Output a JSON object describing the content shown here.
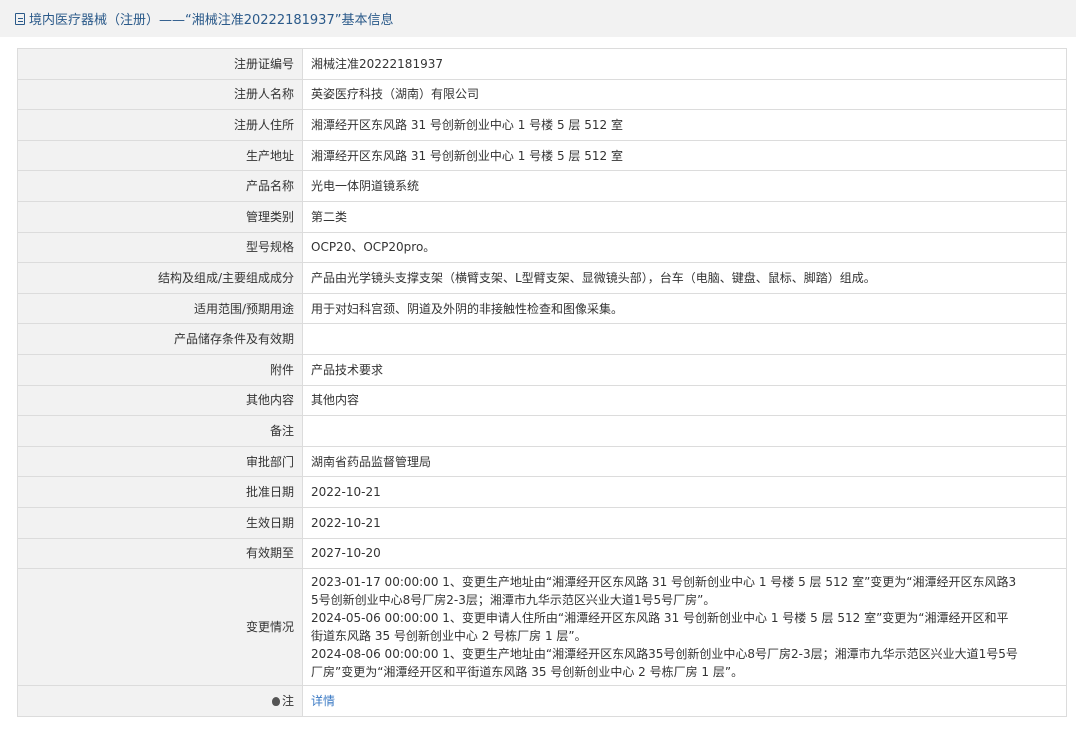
{
  "header": {
    "title": "境内医疗器械（注册）——“湘械注准20222181937”基本信息"
  },
  "rows": [
    {
      "label": "注册证编号",
      "value": "湘械注准20222181937"
    },
    {
      "label": "注册人名称",
      "value": "英姿医疗科技（湖南）有限公司"
    },
    {
      "label": "注册人住所",
      "value": "湘潭经开区东风路 31 号创新创业中心 1 号楼 5 层 512 室"
    },
    {
      "label": "生产地址",
      "value": "湘潭经开区东风路 31 号创新创业中心 1 号楼 5 层 512 室"
    },
    {
      "label": "产品名称",
      "value": "光电一体阴道镜系统"
    },
    {
      "label": "管理类别",
      "value": "第二类"
    },
    {
      "label": "型号规格",
      "value": "OCP20、OCP20pro。"
    },
    {
      "label": "结构及组成/主要组成成分",
      "value": "产品由光学镜头支撑支架（横臂支架、L型臂支架、显微镜头部），台车（电脑、键盘、鼠标、脚踏）组成。"
    },
    {
      "label": "适用范围/预期用途",
      "value": "用于对妇科宫颈、阴道及外阴的非接触性检查和图像采集。"
    },
    {
      "label": "产品储存条件及有效期",
      "value": ""
    },
    {
      "label": "附件",
      "value": "产品技术要求"
    },
    {
      "label": "其他内容",
      "value": "其他内容"
    },
    {
      "label": "备注",
      "value": ""
    },
    {
      "label": "审批部门",
      "value": "湖南省药品监督管理局"
    },
    {
      "label": "批准日期",
      "value": "2022-10-21"
    },
    {
      "label": "生效日期",
      "value": "2022-10-21"
    },
    {
      "label": "有效期至",
      "value": "2027-10-20"
    }
  ],
  "changes": {
    "label": "变更情况",
    "lines": [
      "2023-01-17 00:00:00 1、变更生产地址由“湘潭经开区东风路 31 号创新创业中心 1 号楼 5 层 512 室”变更为“湘潭经开区东风路3",
      "5号创新创业中心8号厂房2-3层；湘潭市九华示范区兴业大道1号5号厂房”。",
      "2024-05-06 00:00:00 1、变更申请人住所由“湘潭经开区东风路 31 号创新创业中心 1 号楼 5 层 512 室”变更为“湘潭经开区和平",
      "街道东风路 35 号创新创业中心 2 号栋厂房 1 层”。",
      "2024-08-06 00:00:00 1、变更生产地址由“湘潭经开区东风路35号创新创业中心8号厂房2-3层；湘潭市九华示范区兴业大道1号5号",
      "厂房”变更为“湘潭经开区和平街道东风路 35 号创新创业中心 2 号栋厂房 1 层”。"
    ]
  },
  "note": {
    "label": "注",
    "link": "详情"
  }
}
